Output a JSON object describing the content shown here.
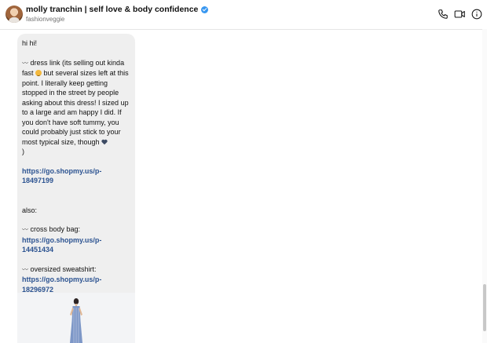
{
  "header": {
    "display_name": "molly tranchin | self love & body confidence",
    "username": "fashionveggie",
    "icons": [
      "phone-icon",
      "video-icon",
      "info-icon"
    ],
    "verified_color": "#3897f0"
  },
  "message": {
    "greeting": "hi hi!",
    "dress_line_1": "dress link (its selling out kinda fast",
    "dress_line_2": "but several sizes left at this point.  I literally keep getting stopped in the street by people asking about this dress! I sized up to a large and am happy I did. If you don't have soft tummy, you could probably just stick to your most typical size, though",
    "dress_line_end": ")",
    "dress_link": "https://go.shopmy.us/p-18497199",
    "also": "also:",
    "bag_label": "cross body bag:",
    "bag_link": "https://go.shopmy.us/p-14451434",
    "sweatshirt_label": "oversized sweatshirt:",
    "sweatshirt_link": "https://go.shopmy.us/p-18296972",
    "link_color": "#2c5391",
    "bubble_color": "#efefef"
  }
}
